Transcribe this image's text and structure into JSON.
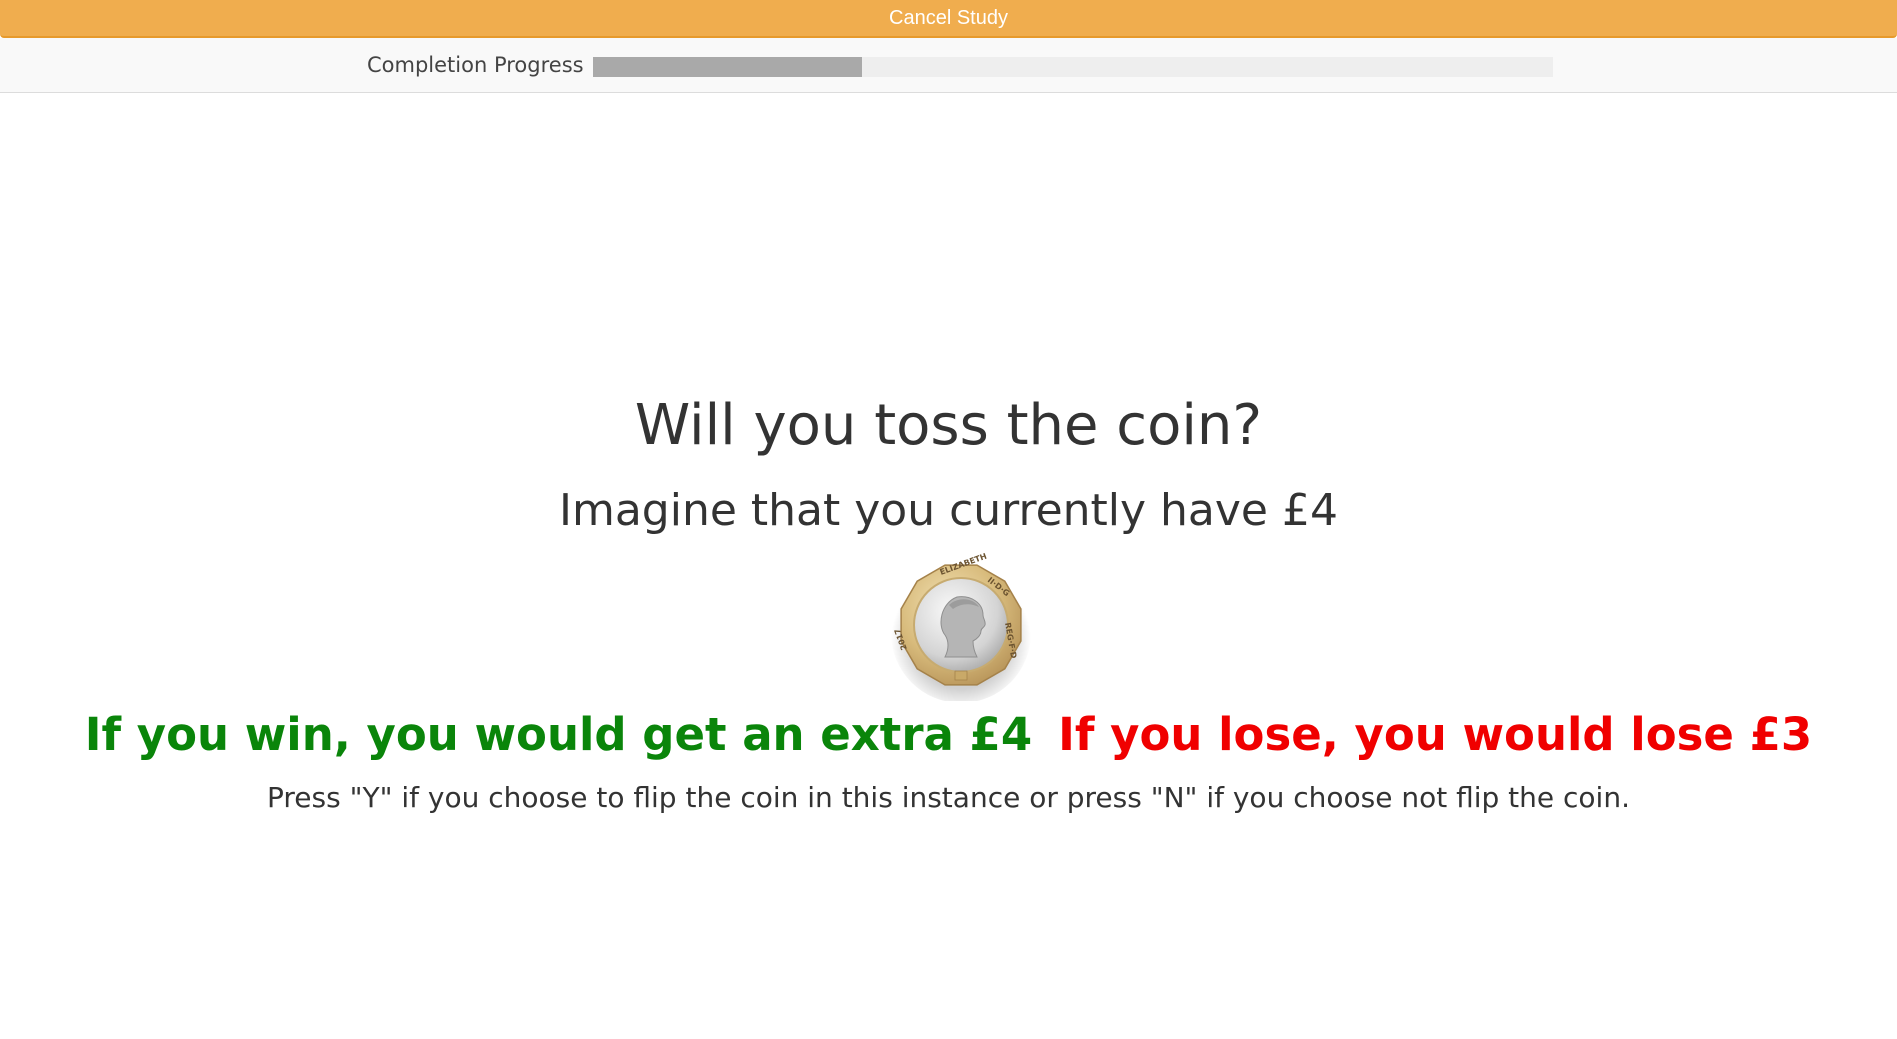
{
  "header": {
    "cancel_label": "Cancel Study",
    "accent_color": "#f0ad4e"
  },
  "progress": {
    "label": "Completion Progress",
    "fraction": 0.28
  },
  "main": {
    "question": "Will you toss the coin?",
    "imagine": "Imagine that you currently have £4",
    "coin_icon": "one-pound-coin-icon",
    "win_text": "If you win, you would get an extra £4",
    "win_color": "#0a850a",
    "lose_text": "If you lose, you would lose £3",
    "lose_color": "#f00000",
    "instruction": "Press \"Y\" if you choose to flip the coin in this instance or press \"N\" if you choose not flip the coin."
  }
}
